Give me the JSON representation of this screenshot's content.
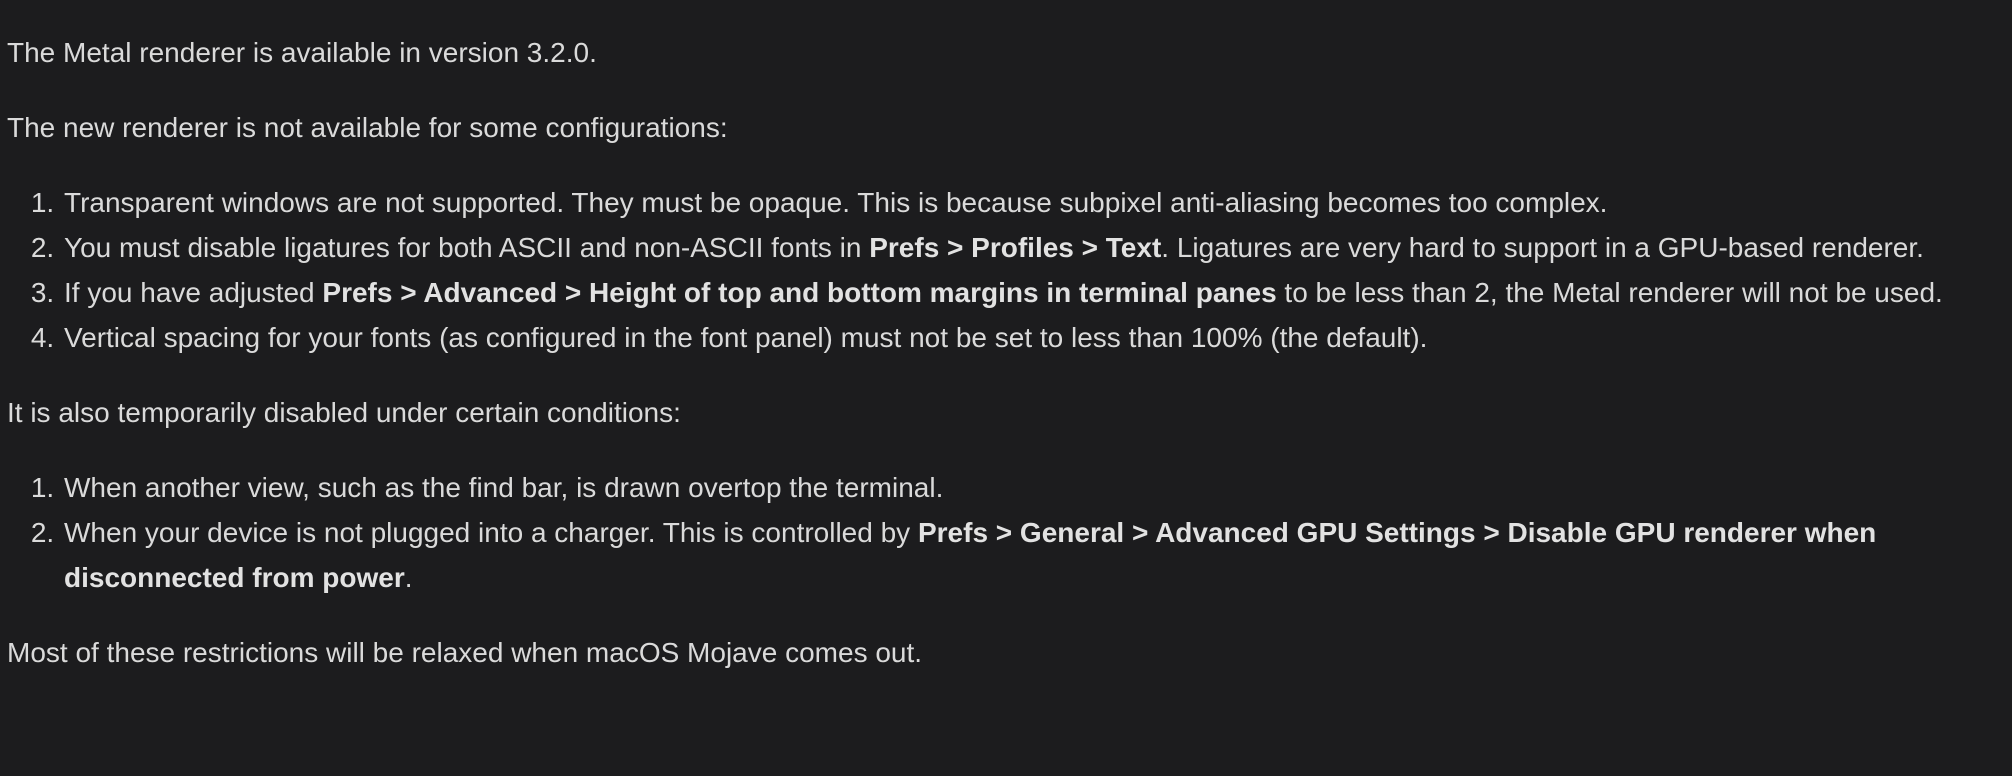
{
  "intro": "The Metal renderer is available in version 3.2.0.",
  "config_heading": "The new renderer is not available for some configurations:",
  "config_items": [
    {
      "t1": "Transparent windows are not supported. They must be opaque. This is because subpixel anti-aliasing becomes too complex."
    },
    {
      "t1": "You must disable ligatures for both ASCII and non-ASCII fonts in ",
      "b1": "Prefs > Profiles > Text",
      "t2": ". Ligatures are very hard to support in a GPU-based renderer."
    },
    {
      "t1": "If you have adjusted ",
      "b1": "Prefs > Advanced > Height of top and bottom margins in terminal panes",
      "t2": " to be less than 2, the Metal renderer will not be used."
    },
    {
      "t1": "Vertical spacing for your fonts (as configured in the font panel) must not be set to less than 100% (the default)."
    }
  ],
  "conditions_heading": "It is also temporarily disabled under certain conditions:",
  "condition_items": [
    {
      "t1": "When another view, such as the find bar, is drawn overtop the terminal."
    },
    {
      "t1": "When your device is not plugged into a charger. This is controlled by ",
      "b1": "Prefs > General > Advanced GPU Settings > Disable GPU renderer when disconnected from power",
      "t2": "."
    }
  ],
  "closing": "Most of these restrictions will be relaxed when macOS Mojave comes out."
}
